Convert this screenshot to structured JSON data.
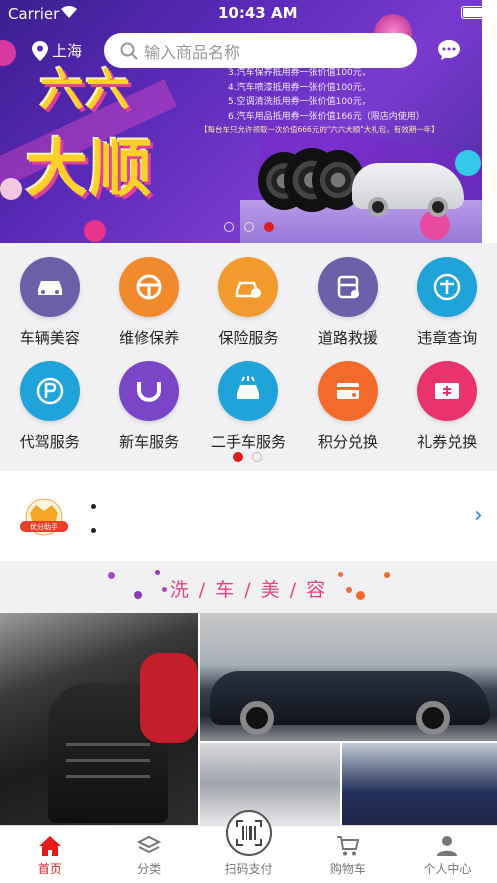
{
  "status_bar": {
    "carrier": "Carrier",
    "time": "10:43 AM"
  },
  "top_bar": {
    "location": "上海",
    "search_placeholder": "输入商品名称"
  },
  "banner": {
    "headline_top": "六六",
    "headline_bottom": "大顺",
    "promo_lines": [
      "3.汽车保养抵用券一张价值100元，",
      "4.汽车喷漆抵用券一张价值100元，",
      "5.空调清洗抵用券一张价值100元，",
      "6.汽车用品抵用券一张价值166元（限店内使用）"
    ],
    "promo_note": "【每台车只允许领取一次价值666元的\"六六大顺\"大礼包，有效期一年】",
    "page_count": 3,
    "active_page": 3
  },
  "services": [
    {
      "label": "车辆美容",
      "icon": "car-wash-icon",
      "color": "#6c5fa8"
    },
    {
      "label": "维修保养",
      "icon": "steering-wheel-icon",
      "color": "#f08a2c"
    },
    {
      "label": "保险服务",
      "icon": "car-insurance-icon",
      "color": "#f39a2e"
    },
    {
      "label": "道路救援",
      "icon": "tow-truck-icon",
      "color": "#6c5fa8"
    },
    {
      "label": "违章查询",
      "icon": "violation-icon",
      "color": "#1fa3d8"
    },
    {
      "label": "代驾服务",
      "icon": "parking-icon",
      "color": "#1fa3d8"
    },
    {
      "label": "新车服务",
      "icon": "new-car-icon",
      "color": "#7b45c8"
    },
    {
      "label": "二手车服务",
      "icon": "used-car-icon",
      "color": "#1fa3d8"
    },
    {
      "label": "积分兑换",
      "icon": "points-card-icon",
      "color": "#f36a2a"
    },
    {
      "label": "礼券兑换",
      "icon": "coupon-icon",
      "color": "#e8336d"
    }
  ],
  "services_pager": {
    "page_count": 2,
    "active_page": 1
  },
  "notice": {
    "badge_text": "优分助手"
  },
  "section": {
    "title": "洗 / 车 / 美 / 容"
  },
  "tabbar": [
    {
      "label": "首页",
      "icon": "home-icon",
      "active": true
    },
    {
      "label": "分类",
      "icon": "layers-icon",
      "active": false
    },
    {
      "label": "扫码支付",
      "icon": "scan-icon",
      "active": false
    },
    {
      "label": "购物车",
      "icon": "cart-icon",
      "active": false
    },
    {
      "label": "个人中心",
      "icon": "user-icon",
      "active": false
    }
  ],
  "colors": {
    "accent": "#e01c1c",
    "section_title": "#e6457a",
    "link": "#1a8cff"
  }
}
